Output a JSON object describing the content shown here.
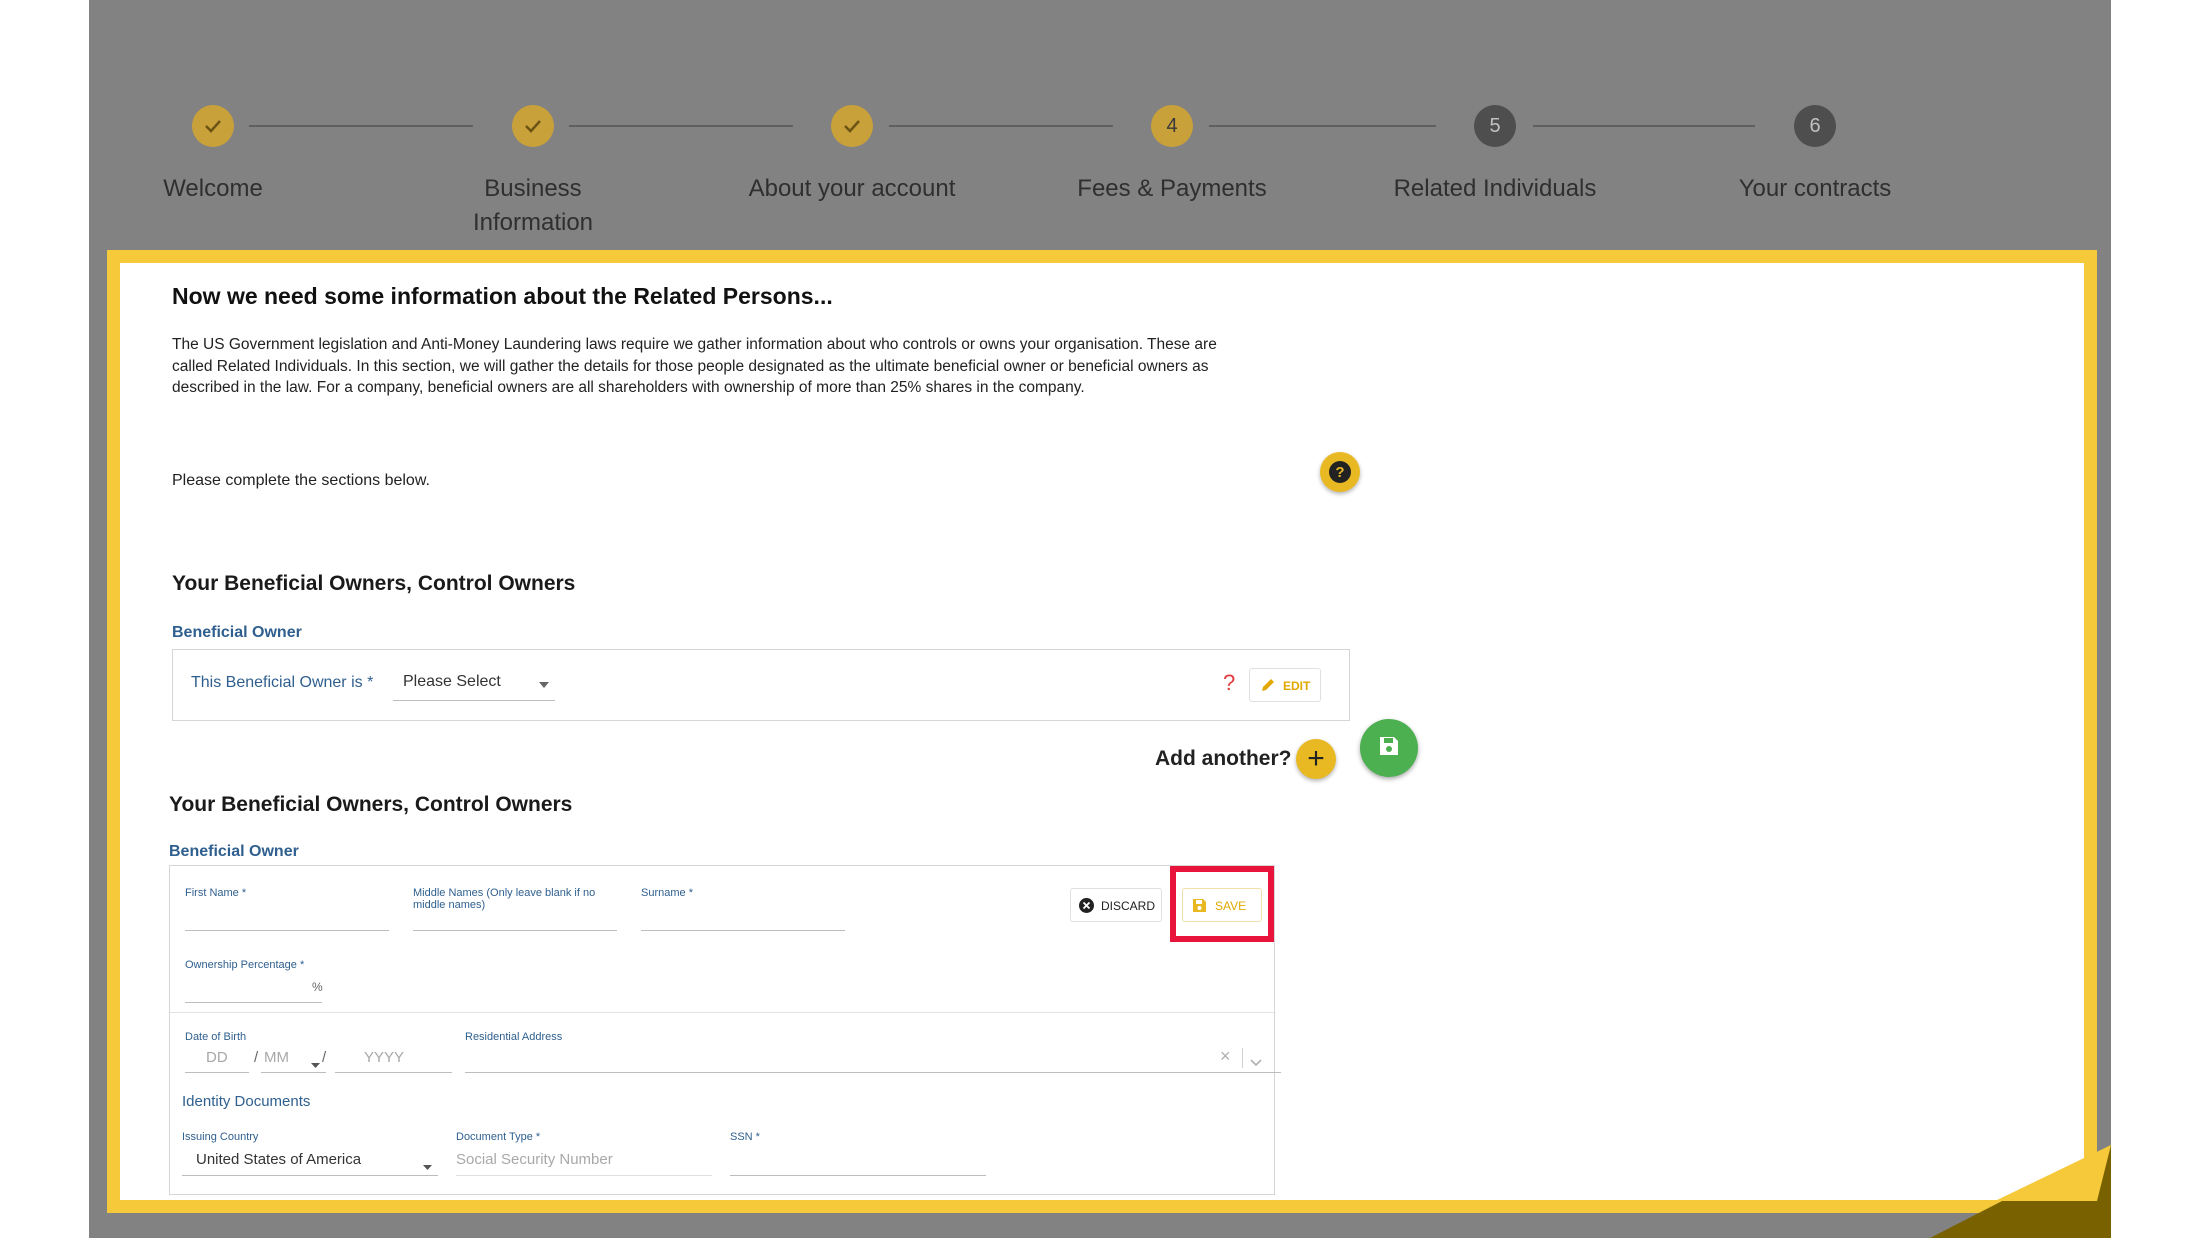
{
  "stepper": {
    "steps": [
      {
        "label": "Welcome",
        "state": "done"
      },
      {
        "label": "Business Information",
        "state": "done"
      },
      {
        "label": "About your account",
        "state": "done"
      },
      {
        "label": "Fees & Payments",
        "number": "4",
        "state": "current"
      },
      {
        "label": "Related Individuals",
        "number": "5",
        "state": "todo"
      },
      {
        "label": "Your contracts",
        "number": "6",
        "state": "todo"
      }
    ]
  },
  "intro": {
    "heading": "Now we need some information about the Related Persons...",
    "lines": [
      "The US Government legislation and Anti-Money Laundering laws require we gather information about who controls or owns your organisation. These are",
      "called Related Individuals. In this section, we will gather the details for those people designated as the ultimate beneficial owner or beneficial owners as",
      "described in the law. For a company, beneficial owners are all shareholders with ownership of more than 25% shares in the company."
    ],
    "instruction": "Please complete the sections below."
  },
  "section1": {
    "heading": "Your Beneficial Owners, Control Owners",
    "subheading": "Beneficial Owner",
    "field_label": "This Beneficial Owner is *",
    "select_value": "Please Select",
    "question_mark": "?",
    "edit_label": "EDIT"
  },
  "add_another": {
    "label": "Add another?",
    "plus": "+"
  },
  "section2": {
    "heading": "Your Beneficial Owners, Control Owners",
    "subheading": "Beneficial Owner",
    "first_name_label": "First Name *",
    "middle_names_label": "Middle Names (Only leave blank if no middle names)",
    "surname_label": "Surname *",
    "discard_label": "DISCARD",
    "save_label": "SAVE",
    "ownership_label": "Ownership Percentage *",
    "percent_symbol": "%",
    "dob_label": "Date of Birth",
    "dob_dd": "DD",
    "dob_sep1": "/",
    "dob_mm": "MM",
    "dob_sep2": "/",
    "dob_yyyy": "YYYY",
    "address_label": "Residential Address",
    "clear_symbol": "×",
    "identity_heading": "Identity Documents",
    "issuing_country_label": "Issuing Country",
    "issuing_country_value": "United States of America",
    "document_type_label": "Document Type *",
    "document_type_placeholder": "Social Security Number",
    "ssn_label": "SSN *"
  },
  "colors": {
    "accent_yellow": "#f6c93b",
    "icon_yellow": "#e8b923",
    "save_green": "#4caf50",
    "highlight_red": "#e8143b",
    "overlay_gray": "#828282",
    "label_blue": "#2f5f8e"
  }
}
